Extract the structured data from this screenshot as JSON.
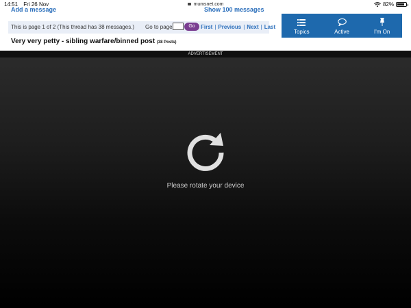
{
  "status_bar": {
    "time": "14:51",
    "date": "Fri 26 Nov",
    "url": "mumsnet.com",
    "battery": "82%",
    "battery_level": 0.82
  },
  "cut_links": {
    "left": "Add a message",
    "right": "Show 100 messages"
  },
  "pager": {
    "info": "This is page 1 of 2 (This thread has 38 messages.)",
    "goto_label": "Go to page",
    "page_value": "",
    "go_label": "Go",
    "links": [
      "First",
      "Previous",
      "Next",
      "Last"
    ]
  },
  "top_nav": {
    "items": [
      {
        "label": "Topics",
        "icon": "list-icon"
      },
      {
        "label": "Active",
        "icon": "speech-bubble-icon"
      },
      {
        "label": "I'm On",
        "icon": "pin-icon"
      }
    ]
  },
  "thread": {
    "title": "Very very petty - sibling warfare/binned post",
    "posts": "(38 Posts)"
  },
  "ad_label": "ADVERTISEMENT",
  "overlay": {
    "message": "Please rotate your device",
    "icon": "rotate-icon"
  },
  "colors": {
    "nav_blue": "#1e69ad",
    "link_blue": "#2a6ebb",
    "go_purple": "#7a3e91",
    "pager_bg": "#e9eef7"
  }
}
